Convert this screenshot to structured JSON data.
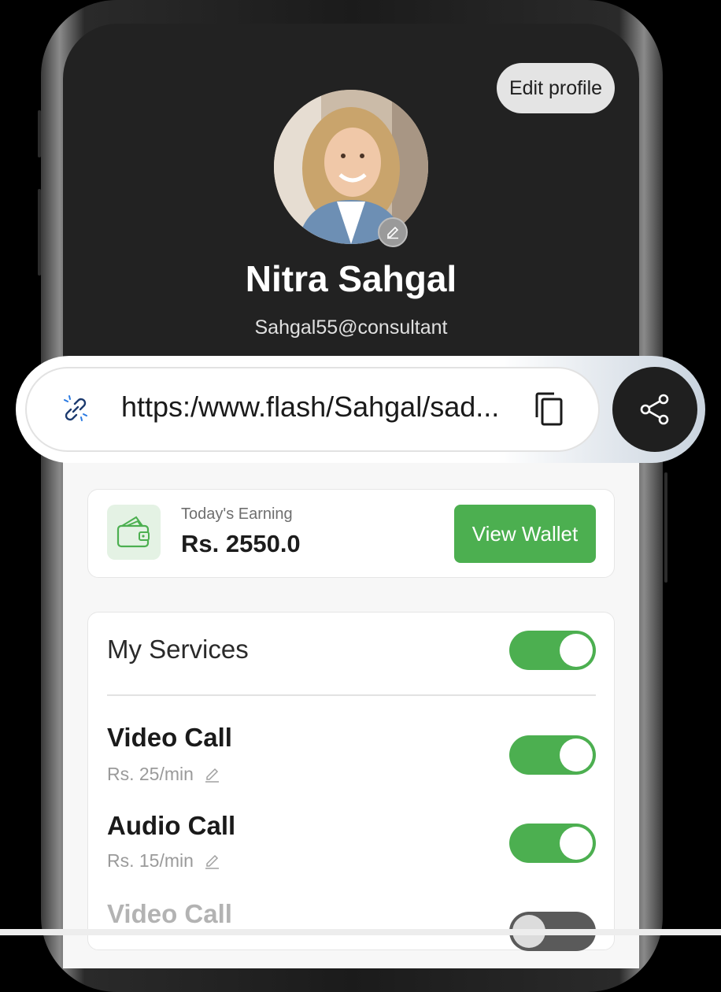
{
  "profile": {
    "edit_label": "Edit profile",
    "name": "Nitra Sahgal",
    "handle": "Sahgal55@consultant"
  },
  "share_link": {
    "url": "https:/www.flash/Sahgal/sad..."
  },
  "earnings": {
    "label": "Today's Earning",
    "value": "Rs. 2550.0",
    "button_label": "View Wallet"
  },
  "services": {
    "title": "My Services",
    "enabled": true,
    "items": [
      {
        "name": "Video Call",
        "price": "Rs. 25/min",
        "enabled": true
      },
      {
        "name": "Audio Call",
        "price": "Rs. 15/min",
        "enabled": true
      },
      {
        "name": "Video Call",
        "price": "",
        "enabled": false
      }
    ]
  },
  "colors": {
    "accent_green": "#4caf50",
    "dark_bg": "#222222",
    "light_bg": "#f7f7f7"
  }
}
